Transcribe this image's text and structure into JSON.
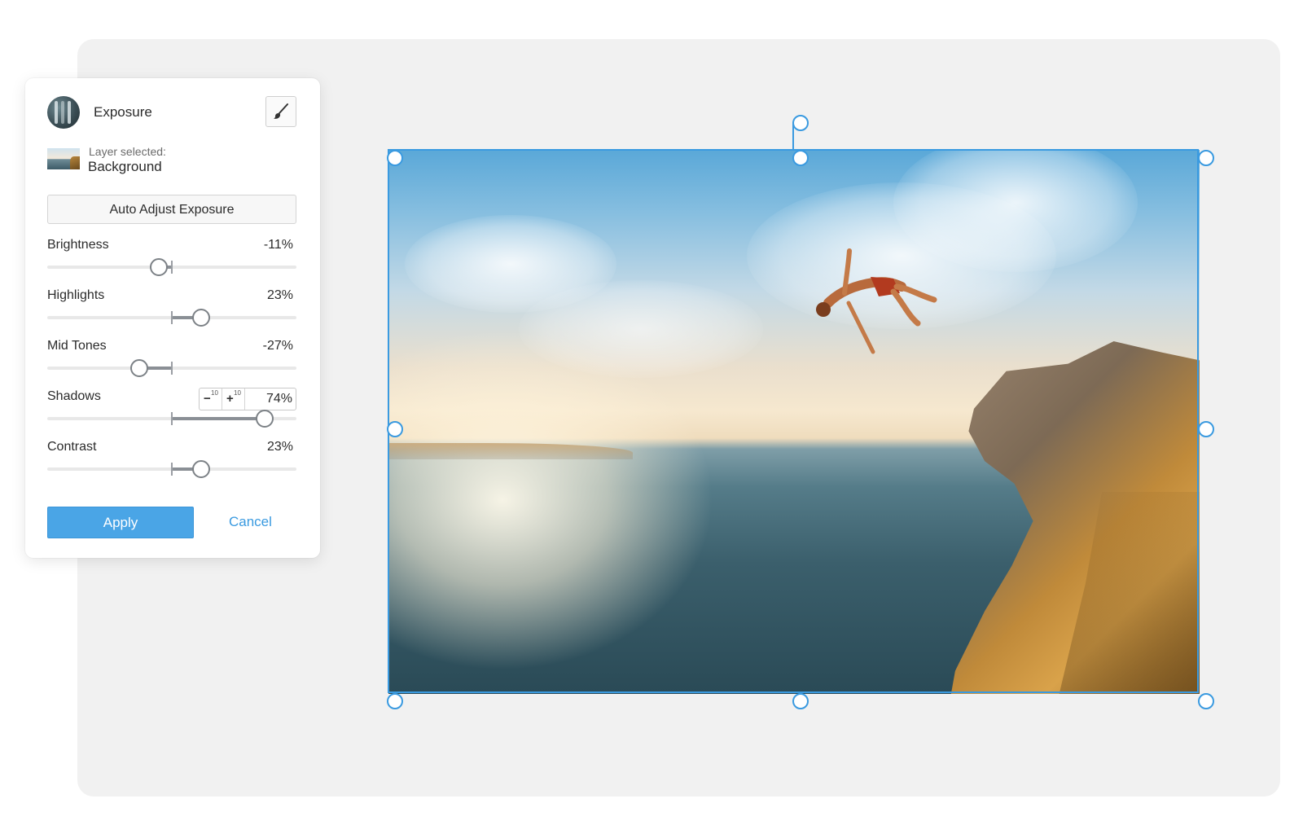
{
  "panel": {
    "title": "Exposure",
    "tool_icon": "exposure-tool-icon",
    "brush_icon": "brush-icon",
    "layer_label": "Layer selected:",
    "layer_name": "Background",
    "auto_adjust_label": "Auto Adjust Exposure"
  },
  "adjustments": [
    {
      "label": "Brightness",
      "value": "-11%",
      "level": -11
    },
    {
      "label": "Highlights",
      "value": "23%",
      "level": 23
    },
    {
      "label": "Mid Tones",
      "value": "-27%",
      "level": -27
    },
    {
      "label": "Shadows",
      "value": "74%",
      "level": 74
    },
    {
      "label": "Contrast",
      "value": "23%",
      "level": 23
    }
  ],
  "stepper": {
    "minus_symbol": "−",
    "minus_amount": "10",
    "plus_symbol": "+",
    "plus_amount": "10"
  },
  "actions": {
    "apply_label": "Apply",
    "cancel_label": "Cancel"
  },
  "colors": {
    "accent": "#4aa5e6",
    "selection": "#3a9ae0",
    "slider_fill": "#8a8f95"
  },
  "canvas": {
    "image_subject": "cliff-diver-over-ocean"
  }
}
